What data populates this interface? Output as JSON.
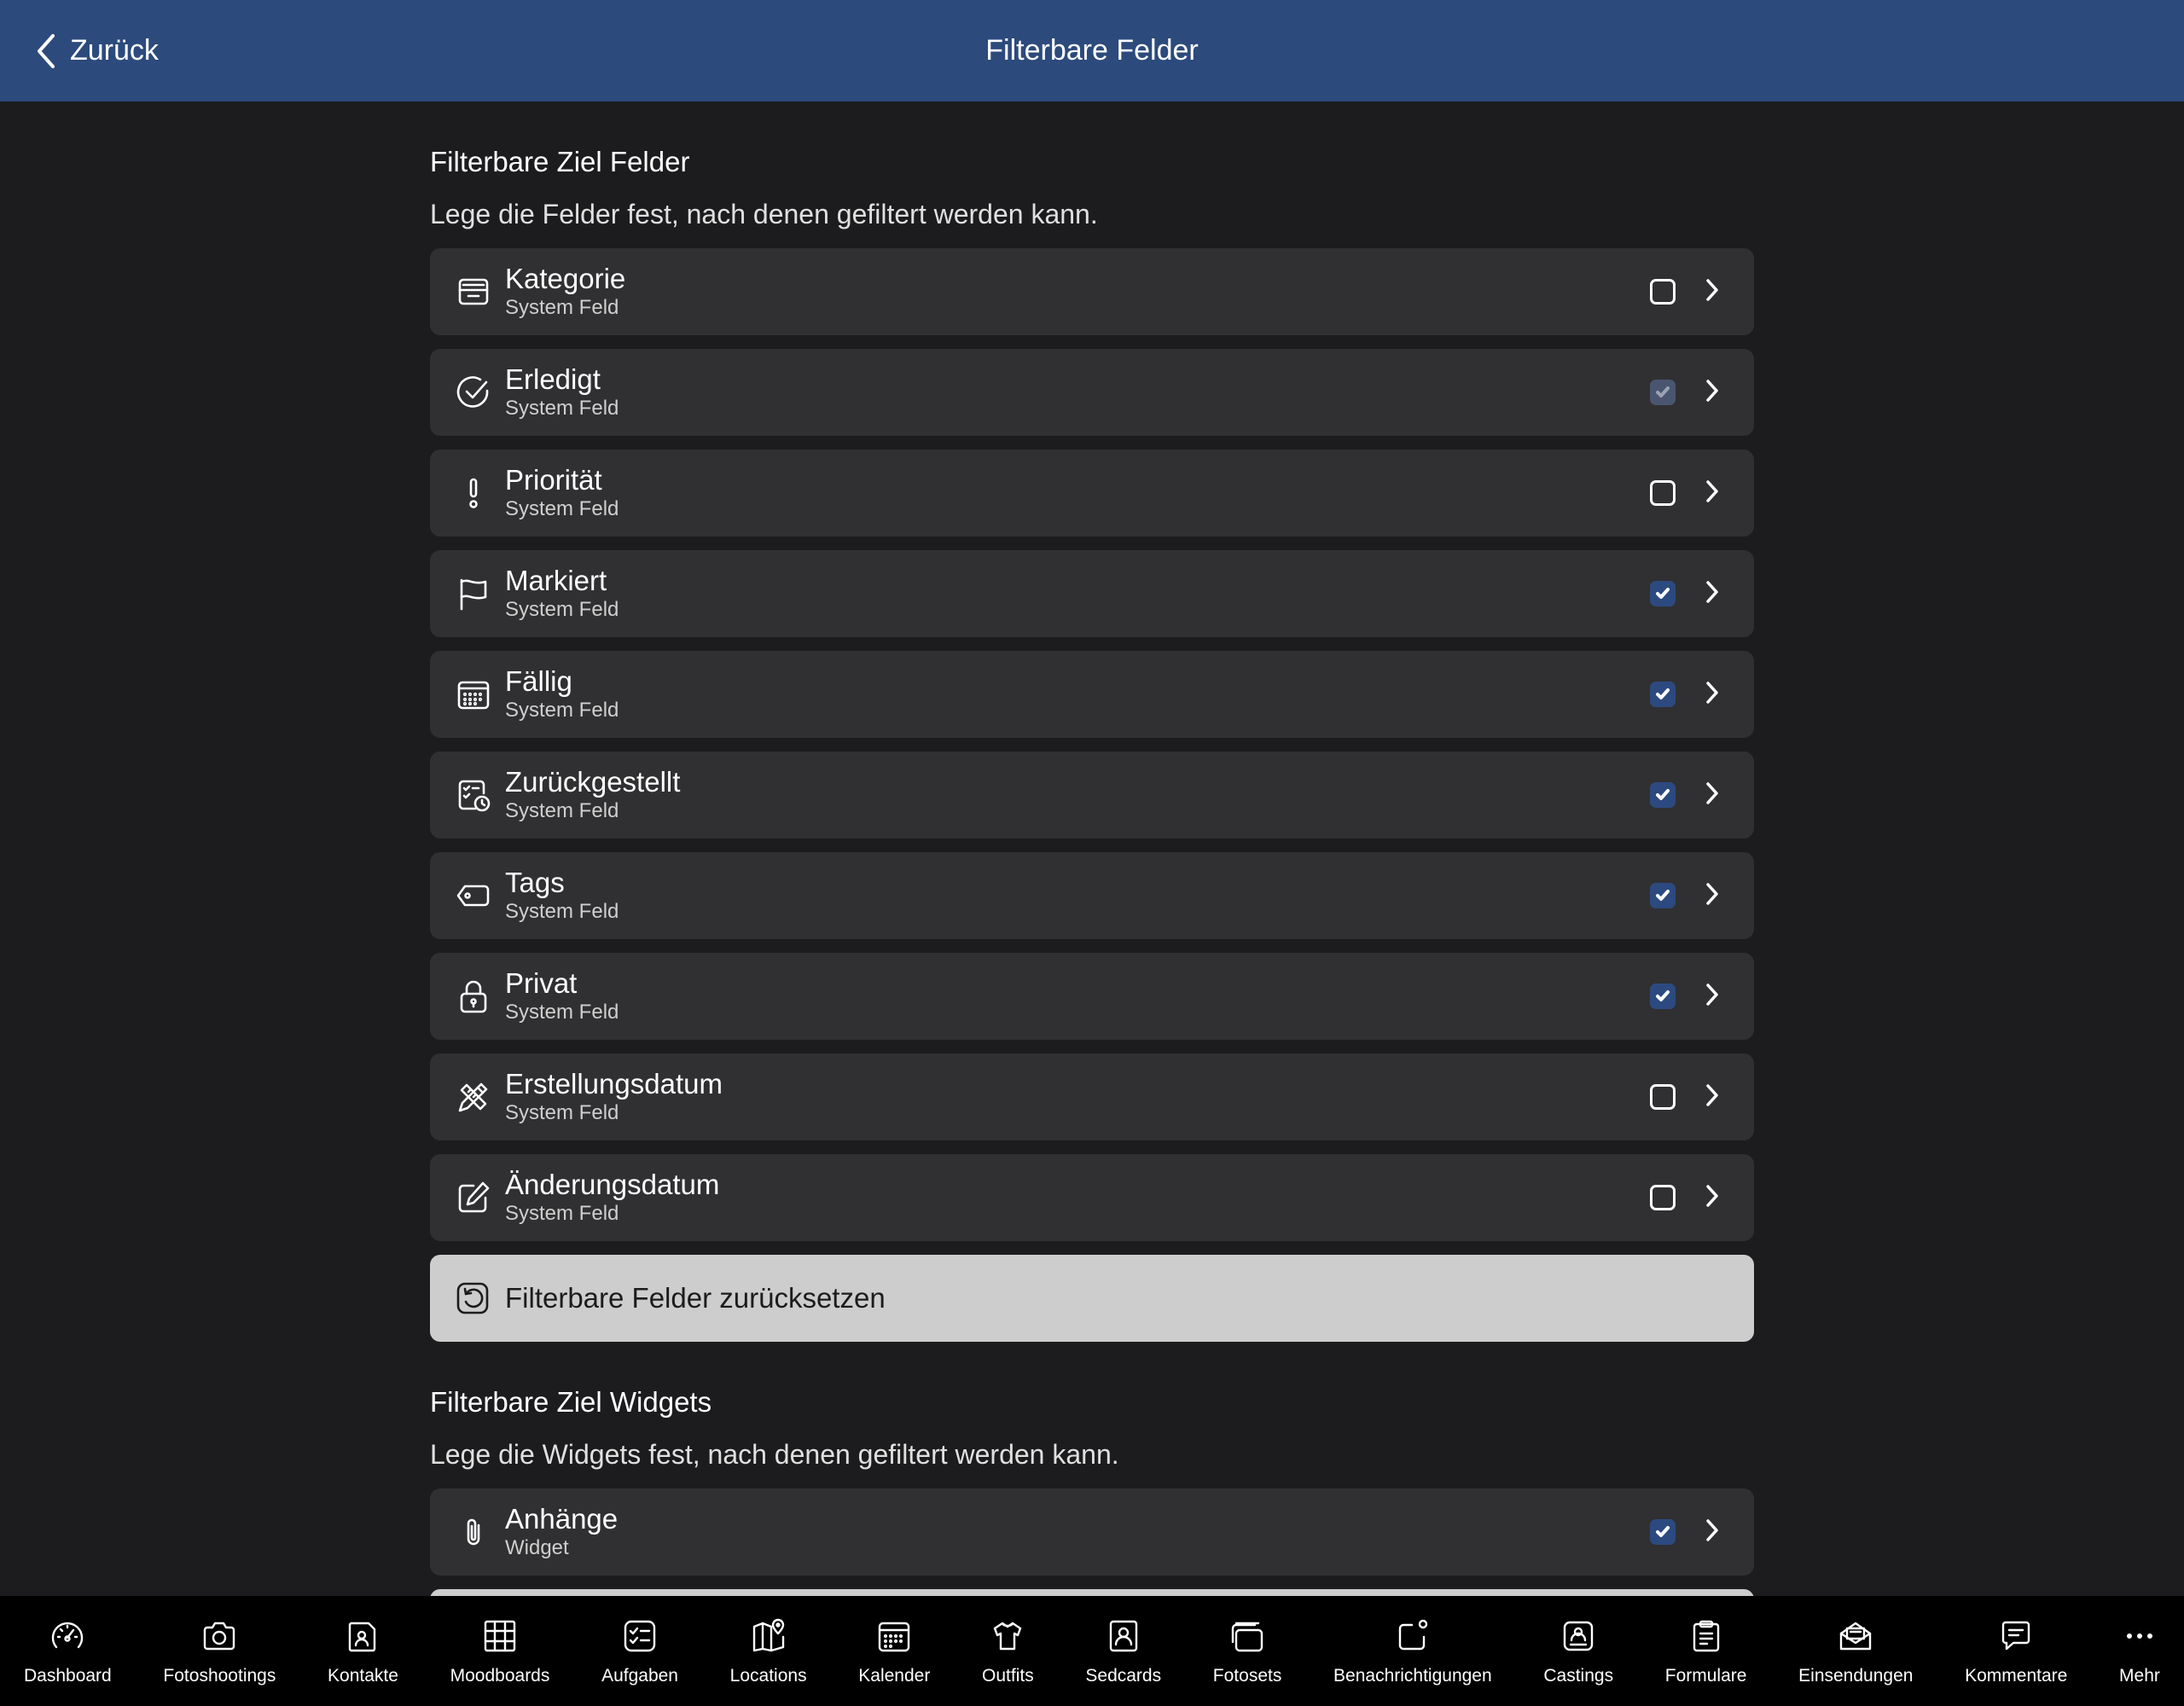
{
  "header": {
    "back_label": "Zurück",
    "title": "Filterbare Felder"
  },
  "fields_section": {
    "title": "Filterbare Ziel Felder",
    "description": "Lege die Felder fest, nach denen gefiltert werden kann.",
    "items": [
      {
        "label": "Kategorie",
        "sub": "System Feld",
        "icon": "tray-icon",
        "checked": false
      },
      {
        "label": "Erledigt",
        "sub": "System Feld",
        "icon": "check-circle-icon",
        "checked": "dim"
      },
      {
        "label": "Priorität",
        "sub": "System Feld",
        "icon": "exclamation-icon",
        "checked": false
      },
      {
        "label": "Markiert",
        "sub": "System Feld",
        "icon": "flag-icon",
        "checked": true
      },
      {
        "label": "Fällig",
        "sub": "System Feld",
        "icon": "calendar-icon",
        "checked": true
      },
      {
        "label": "Zurückgestellt",
        "sub": "System Feld",
        "icon": "snooze-icon",
        "checked": true
      },
      {
        "label": "Tags",
        "sub": "System Feld",
        "icon": "tag-icon",
        "checked": true
      },
      {
        "label": "Privat",
        "sub": "System Feld",
        "icon": "lock-icon",
        "checked": true
      },
      {
        "label": "Erstellungsdatum",
        "sub": "System Feld",
        "icon": "pencil-ruler-icon",
        "checked": false
      },
      {
        "label": "Änderungsdatum",
        "sub": "System Feld",
        "icon": "edit-icon",
        "checked": false
      }
    ],
    "reset_label": "Filterbare Felder zurücksetzen"
  },
  "widgets_section": {
    "title": "Filterbare Ziel Widgets",
    "description": "Lege die Widgets fest, nach denen gefiltert werden kann.",
    "items": [
      {
        "label": "Anhänge",
        "sub": "Widget",
        "icon": "paperclip-icon",
        "checked": true
      }
    ]
  },
  "tabbar": [
    {
      "label": "Dashboard",
      "icon": "speedometer-icon"
    },
    {
      "label": "Fotoshootings",
      "icon": "camera-icon"
    },
    {
      "label": "Kontakte",
      "icon": "contact-icon"
    },
    {
      "label": "Moodboards",
      "icon": "grid-icon"
    },
    {
      "label": "Aufgaben",
      "icon": "checklist-icon"
    },
    {
      "label": "Locations",
      "icon": "map-icon"
    },
    {
      "label": "Kalender",
      "icon": "calendar-icon"
    },
    {
      "label": "Outfits",
      "icon": "hanger-icon"
    },
    {
      "label": "Sedcards",
      "icon": "portrait-icon"
    },
    {
      "label": "Fotosets",
      "icon": "photo-stack-icon"
    },
    {
      "label": "Benachrichtigungen",
      "icon": "notification-icon"
    },
    {
      "label": "Castings",
      "icon": "casting-icon"
    },
    {
      "label": "Formulare",
      "icon": "clipboard-icon"
    },
    {
      "label": "Einsendungen",
      "icon": "mail-icon"
    },
    {
      "label": "Kommentare",
      "icon": "comment-icon"
    },
    {
      "label": "Mehr",
      "icon": "more-icon"
    }
  ]
}
